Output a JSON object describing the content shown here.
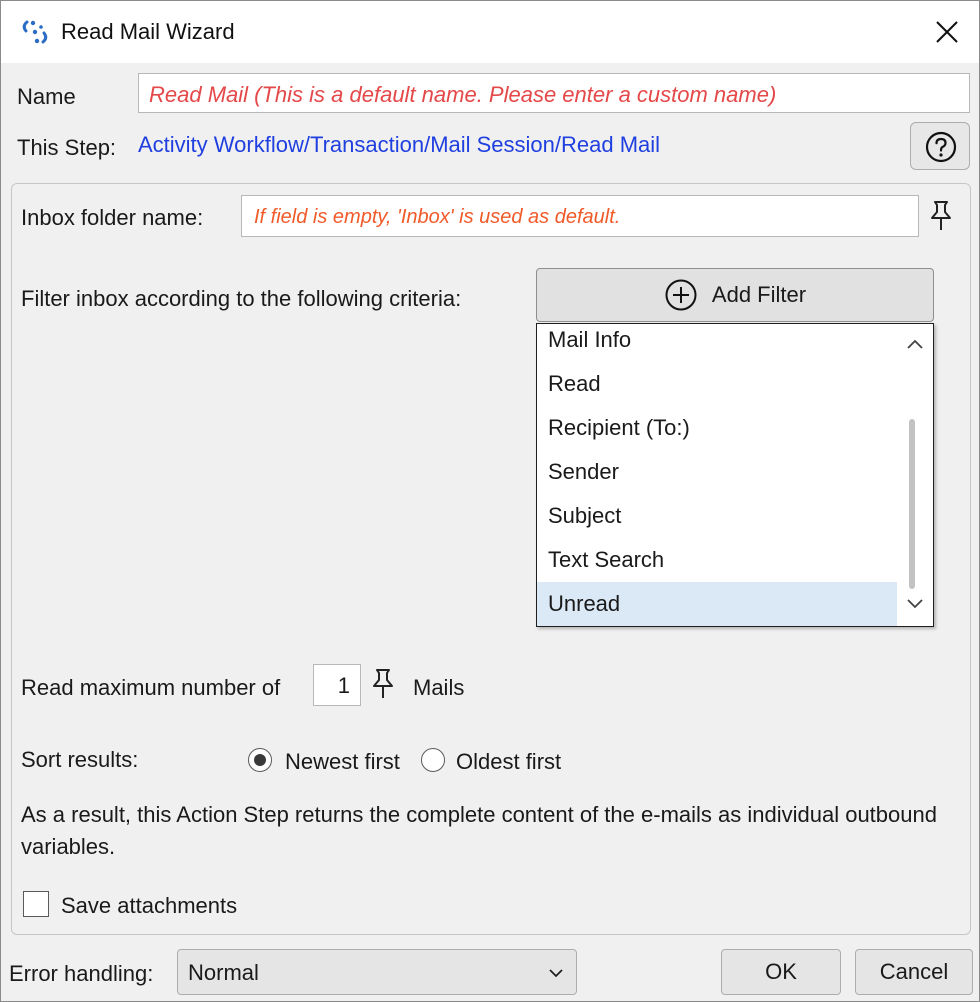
{
  "window": {
    "title": "Read Mail Wizard",
    "app_icon": "wizard-app-icon",
    "close_icon": "close-icon"
  },
  "name_row": {
    "label": "Name",
    "value": "Read Mail  (This is a default name. Please enter a custom name)"
  },
  "step_row": {
    "label": "This Step:",
    "path": "Activity Workflow/Transaction/Mail Session/Read Mail",
    "help_icon": "help-icon"
  },
  "inbox": {
    "label": "Inbox folder name:",
    "placeholder": "If field is empty, 'Inbox' is used as default.",
    "pin_icon": "pin-icon"
  },
  "filter": {
    "label": "Filter inbox according to the following criteria:",
    "add_button": "Add Filter",
    "add_icon": "plus-circle-icon",
    "options": [
      "Mail Info",
      "Read",
      "Recipient (To:)",
      "Sender",
      "Subject",
      "Text Search",
      "Unread"
    ],
    "selected": "Unread"
  },
  "max_mails": {
    "label_before": "Read maximum number of",
    "value": "1",
    "label_after": "Mails"
  },
  "sort": {
    "label": "Sort results:",
    "options": [
      "Newest first",
      "Oldest first"
    ],
    "selected": "Newest first"
  },
  "description": "As a result, this Action Step returns the complete content of the e-mails as individual outbound variables.",
  "save_attachments": {
    "label": "Save attachments",
    "checked": false
  },
  "footer": {
    "error_label": "Error handling:",
    "error_value": "Normal",
    "ok": "OK",
    "cancel": "Cancel"
  },
  "colors": {
    "placeholder_red": "#e54848",
    "placeholder_orange": "#f05a28",
    "link_blue": "#1f3fe0",
    "selection": "#dbe8f6",
    "app_icon_blue": "#2b6cc4"
  }
}
